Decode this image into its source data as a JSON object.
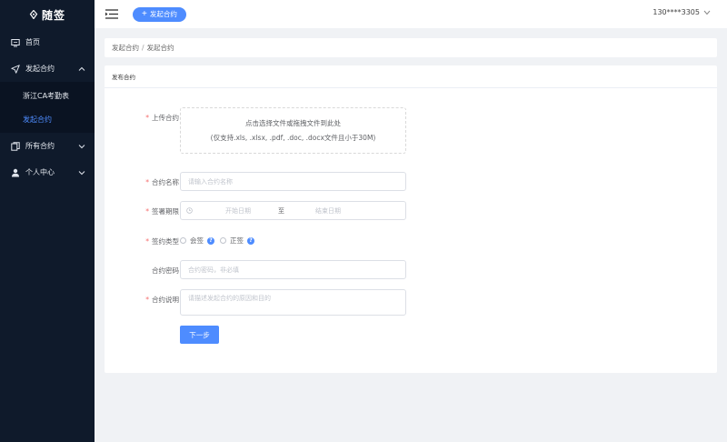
{
  "app": {
    "logo_text": "随签"
  },
  "sidebar": {
    "items": [
      {
        "label": "首页",
        "icon": "monitor-icon"
      },
      {
        "label": "发起合约",
        "icon": "send-icon",
        "expanded": true,
        "children": [
          {
            "label": "浙江CA考勤表",
            "active": false
          },
          {
            "label": "发起合约",
            "active": true
          }
        ]
      },
      {
        "label": "所有合约",
        "icon": "documents-icon",
        "expanded": false
      },
      {
        "label": "个人中心",
        "icon": "user-icon",
        "expanded": false
      }
    ]
  },
  "header": {
    "launch_button": "发起合约",
    "user_phone": "130****3305"
  },
  "breadcrumb": {
    "parent": "发起合约",
    "current": "发起合约"
  },
  "form": {
    "card_title": "发布合约",
    "upload": {
      "label": "上传合约",
      "hint_line1": "点击选择文件或拖拽文件到此处",
      "hint_line2": "(仅支持.xls, .xlsx, .pdf, .doc, .docx文件且小于30M)"
    },
    "name": {
      "label": "合约名称",
      "placeholder": "请输入合约名称",
      "value": ""
    },
    "period": {
      "label": "签署期限",
      "start_placeholder": "开始日期",
      "separator": "至",
      "end_placeholder": "结束日期"
    },
    "sign_type": {
      "label": "签约类型",
      "options": [
        "会签",
        "正签"
      ]
    },
    "password": {
      "label": "合约密码",
      "placeholder": "合约密码，非必填",
      "value": ""
    },
    "description": {
      "label": "合约说明",
      "placeholder": "请描述发起合约的原因和目的",
      "value": ""
    },
    "next_button": "下一步"
  },
  "colors": {
    "primary": "#4e8cff",
    "sidebar_bg": "#0f1a2b",
    "required": "#f56c6c"
  }
}
